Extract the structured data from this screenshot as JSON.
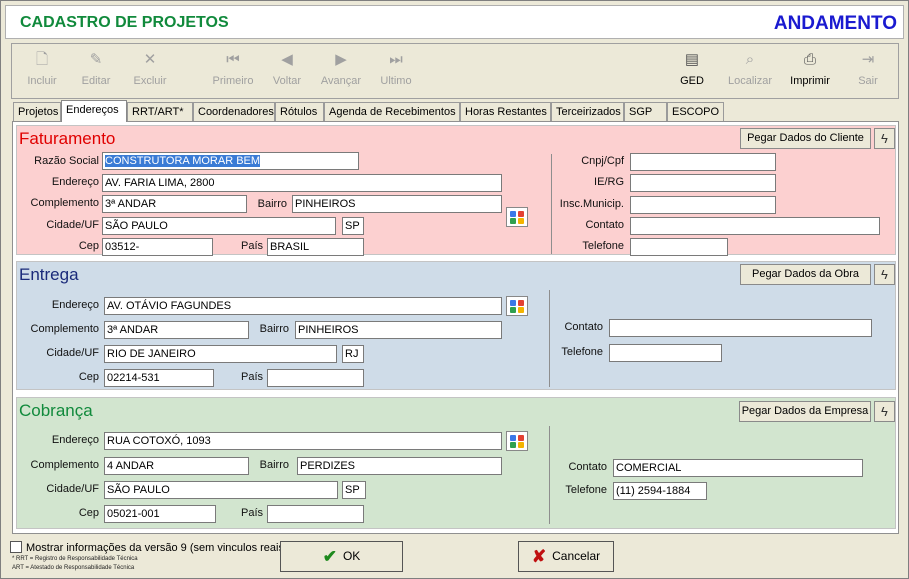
{
  "header": {
    "title": "CADASTRO DE PROJETOS",
    "status": "ANDAMENTO"
  },
  "toolbar": {
    "incluir": "Incluir",
    "editar": "Editar",
    "excluir": "Excluir",
    "primeiro": "Primeiro",
    "voltar": "Voltar",
    "avancar": "Avançar",
    "ultimo": "Ultimo",
    "ged": "GED",
    "localizar": "Localizar",
    "imprimir": "Imprimir",
    "sair": "Sair"
  },
  "tabs": [
    "Projetos",
    "Endereços",
    "RRT/ART*",
    "Coordenadores",
    "Rótulos",
    "Agenda de Recebimentos",
    "Horas Restantes",
    "Terceirizados",
    "SGP",
    "ESCOPO"
  ],
  "faturamento": {
    "title": "Faturamento",
    "button": "Pegar Dados do Cliente",
    "labels": {
      "razao": "Razão Social",
      "endereco": "Endereço",
      "complemento": "Complemento",
      "bairro": "Bairro",
      "cidade": "Cidade/UF",
      "cep": "Cep",
      "pais": "País",
      "cnpj": "Cnpj/Cpf",
      "ie": "IE/RG",
      "insc": "Insc.Municip.",
      "contato": "Contato",
      "telefone": "Telefone"
    },
    "values": {
      "razao": "CONSTRUTORA MORAR BEM",
      "endereco": "AV. FARIA LIMA, 2800",
      "complemento": "3ª ANDAR",
      "bairro": "PINHEIROS",
      "cidade": "SÃO PAULO",
      "uf": "SP",
      "cep": "03512-",
      "pais": "BRASIL",
      "cnpj": "",
      "ie": "",
      "insc": "",
      "contato": "",
      "telefone": ""
    }
  },
  "entrega": {
    "title": "Entrega",
    "button": "Pegar Dados da Obra",
    "labels": {
      "endereco": "Endereço",
      "complemento": "Complemento",
      "bairro": "Bairro",
      "cidade": "Cidade/UF",
      "cep": "Cep",
      "pais": "País",
      "contato": "Contato",
      "telefone": "Telefone"
    },
    "values": {
      "endereco": "AV. OTÁVIO FAGUNDES",
      "complemento": "3ª ANDAR",
      "bairro": "PINHEIROS",
      "cidade": "RIO DE JANEIRO",
      "uf": "RJ",
      "cep": "02214-531",
      "pais": "",
      "contato": "",
      "telefone": ""
    }
  },
  "cobranca": {
    "title": "Cobrança",
    "button": "Pegar Dados da Empresa",
    "labels": {
      "endereco": "Endereço",
      "complemento": "Complemento",
      "bairro": "Bairro",
      "cidade": "Cidade/UF",
      "cep": "Cep",
      "pais": "País",
      "contato": "Contato",
      "telefone": "Telefone"
    },
    "values": {
      "endereco": "RUA COTOXÓ, 1093",
      "complemento": "4 ANDAR",
      "bairro": "PERDIZES",
      "cidade": "SÃO PAULO",
      "uf": "SP",
      "cep": "05021-001",
      "pais": "",
      "contato": "COMERCIAL",
      "telefone": "(11) 2594-1884"
    }
  },
  "footer": {
    "checkbox_label": "Mostrar informações da versão 9 (sem vinculos reais)",
    "note1": "* RRT = Registro de Responsabilidade Técnica",
    "note2": "ART = Atestado de Responsabilidade Técnica",
    "ok": "OK",
    "cancel": "Cancelar"
  },
  "colors": {
    "title_green": "#118a3c",
    "status_blue": "#1a1ad0",
    "faturamento_bg": "#fcd0d0",
    "entrega_bg": "#cfdce8",
    "cobranca_bg": "#d2e5cf"
  }
}
